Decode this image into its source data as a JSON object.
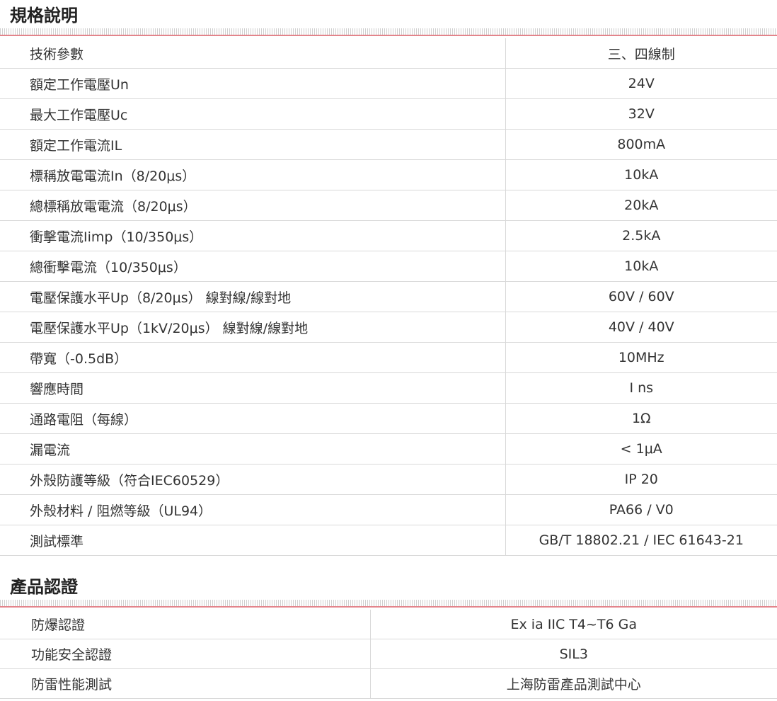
{
  "spec": {
    "title": "規格說明",
    "rows": [
      {
        "label": "技術參數",
        "value": "三、四線制"
      },
      {
        "label": "額定工作電壓Un",
        "value": "24V"
      },
      {
        "label": "最大工作電壓Uc",
        "value": "32V"
      },
      {
        "label": "額定工作電流IL",
        "value": "800mA"
      },
      {
        "label": "標稱放電電流In（8/20μs）",
        "value": "10kA"
      },
      {
        "label": "總標稱放電電流（8/20μs）",
        "value": "20kA"
      },
      {
        "label": "衝擊電流Iimp（10/350μs）",
        "value": "2.5kA"
      },
      {
        "label": "總衝擊電流（10/350μs）",
        "value": "10kA"
      },
      {
        "label": "電壓保護水平Up（8/20μs） 線對線/線對地",
        "value": "60V / 60V"
      },
      {
        "label": "電壓保護水平Up（1kV/20μs） 線對線/線對地",
        "value": "40V / 40V"
      },
      {
        "label": "帶寬（-0.5dB）",
        "value": "10MHz"
      },
      {
        "label": "響應時間",
        "value": "I ns"
      },
      {
        "label": "通路電阻（每線）",
        "value": "1Ω"
      },
      {
        "label": "漏電流",
        "value": "< 1μA"
      },
      {
        "label": "外殼防護等級（符合IEC60529）",
        "value": "IP 20"
      },
      {
        "label": "外殼材料 / 阻燃等級（UL94）",
        "value": "PA66 / V0"
      },
      {
        "label": "測試標準",
        "value": "GB/T 18802.21 / IEC 61643-21"
      }
    ]
  },
  "certification": {
    "title": "產品認證",
    "rows": [
      {
        "label": "防爆認證",
        "value": "Ex ia IIC T4~T6 Ga"
      },
      {
        "label": "功能安全認證",
        "value": "SIL3"
      },
      {
        "label": "防雷性能測試",
        "value": "上海防雷產品測試中心"
      }
    ]
  },
  "colors": {
    "accent_rule": "#e3848b",
    "grid_line": "#d9d9d9"
  }
}
